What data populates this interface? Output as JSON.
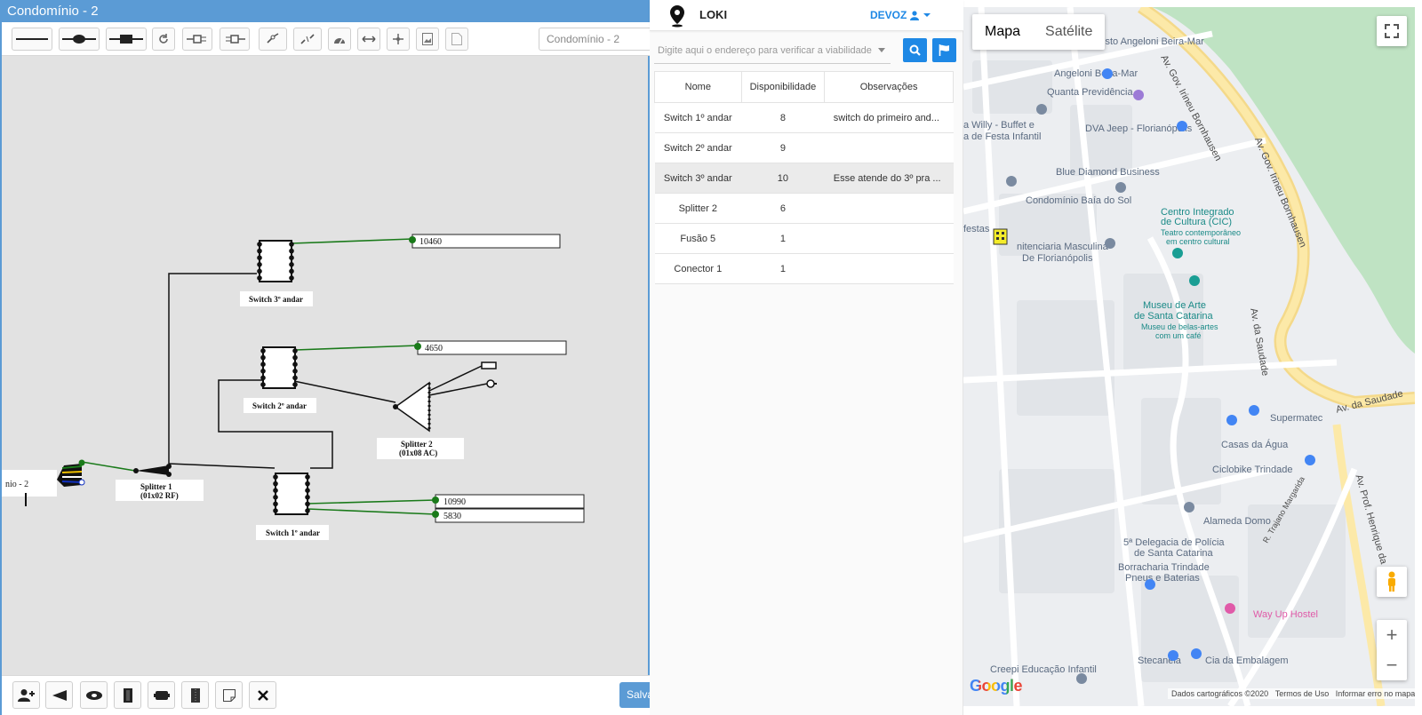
{
  "editor": {
    "title": "Condomínio - 2",
    "select_value": "Condomínio - 2",
    "save_label": "Salvar",
    "toolbar_icons": [
      "line-tool-icon",
      "splice-tool-icon",
      "connector-tool-icon",
      "rotate-icon",
      "plug-icon",
      "plug-alt-icon",
      "link-icon",
      "unlink-icon",
      "gauge-icon",
      "resize-horizontal-icon",
      "move-icon",
      "image-icon",
      "pdf-icon"
    ],
    "bottom_icons": [
      "add-user-icon",
      "splitter-icon",
      "fusion-icon",
      "switch-icon",
      "box-icon",
      "panel-icon",
      "note-icon",
      "close-icon"
    ],
    "diagram": {
      "node_labels": {
        "sw3": "Switch 3º andar",
        "sw2": "Switch 2º andar",
        "sw1": "Switch 1º andar",
        "sp1a": "Splitter 1",
        "sp1b": "(01x02 RF)",
        "sp2a": "Splitter 2",
        "sp2b": "(01x08 AC)",
        "cable": "nio - 2"
      },
      "ports": [
        "10460",
        "4650",
        "10990",
        "5830"
      ]
    }
  },
  "loki": {
    "title": "LOKI",
    "user": "DEVOZ",
    "address_placeholder": "Digite aqui o endereço para verificar a viabilidade",
    "columns": [
      "Nome",
      "Disponibilidade",
      "Observações"
    ],
    "rows": [
      {
        "nome": "Switch 1º andar",
        "disp": "8",
        "obs": "switch do primeiro and..."
      },
      {
        "nome": "Switch 2º andar",
        "disp": "9",
        "obs": ""
      },
      {
        "nome": "Switch 3º andar",
        "disp": "10",
        "obs": "Esse atende do 3º pra ..."
      },
      {
        "nome": "Splitter 2",
        "disp": "6",
        "obs": ""
      },
      {
        "nome": "Fusão 5",
        "disp": "1",
        "obs": ""
      },
      {
        "nome": "Conector 1",
        "disp": "1",
        "obs": ""
      }
    ],
    "selected_row": 2
  },
  "map": {
    "tab_map": "Mapa",
    "tab_satellite": "Satélite",
    "google": "Google",
    "footer": [
      "Dados cartográficos ©2020",
      "Termos de Uso",
      "Informar erro no mapa"
    ],
    "places": {
      "p1": "Posto Angeloni Beira-Mar",
      "p2": "Angeloni Beira-Mar",
      "p3": "Quanta Previdência",
      "p4a": "a Willy - Buffet e",
      "p4b": "a de Festa Infantil",
      "p5": "DVA Jeep - Florianópolis",
      "p6": "Blue Diamond Business",
      "p7": "Condomínio Baía do Sol",
      "p8a": "Centro Integrado",
      "p8b": "de Cultura (CIC)",
      "p8c": "Teatro contemporâneo",
      "p8d": "em centro cultural",
      "p9": "festas",
      "p10a": "nitenciaria Masculina",
      "p10b": "De Florianópolis",
      "p11a": "Museu de Arte",
      "p11b": "de Santa Catarina",
      "p11c": "Museu de belas-artes",
      "p11d": "com um café",
      "p12": "Supermatec",
      "p13": "Casas da Água",
      "p14": "Ciclobike Trindade",
      "p15": "Alameda Domo",
      "p16a": "5ª Delegacia de Polícia",
      "p16b": "de Santa Catarina",
      "p17a": "Borracharia Trindade",
      "p17b": "Pneus e Baterias",
      "p18": "Way Up Hostel",
      "p19": "Stecanela",
      "p20": "Cia da Embalagem",
      "p21": "Creepi Educação Infantil"
    },
    "streets": {
      "s1": "Av. Gov. Irineu Bornhausen",
      "s2": "Av. Gov. Irineu Bornhausen",
      "s3": "Av. da Saudade",
      "s4": "Av. da Saudade",
      "s5": "Av. Prof. Henrique da",
      "s6": "R. Trajano Margarida"
    }
  }
}
